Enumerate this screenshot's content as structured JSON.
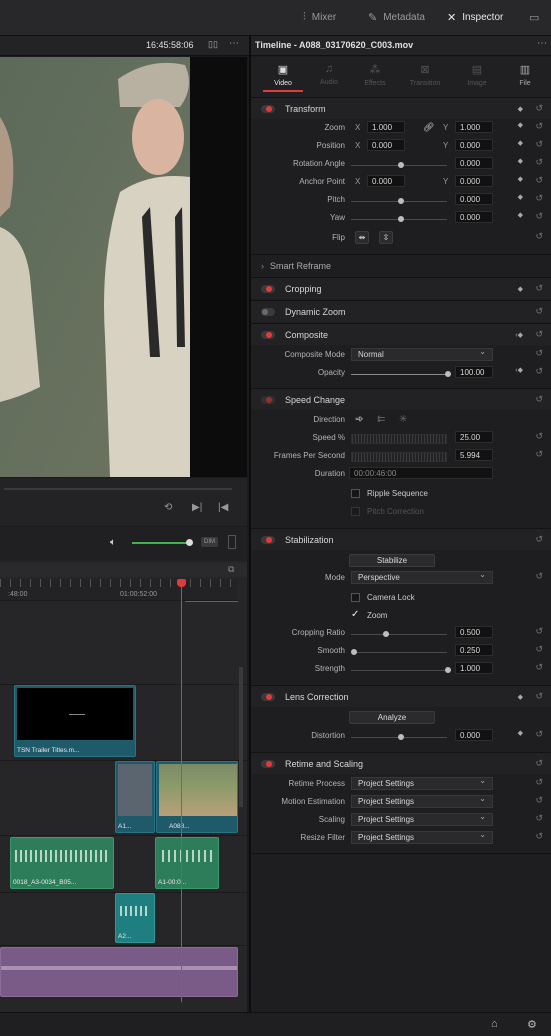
{
  "topbar": {
    "mixer": "Mixer",
    "metadata": "Metadata",
    "inspector": "Inspector"
  },
  "viewer": {
    "timecode": "16:45:58:06"
  },
  "inspector": {
    "title": "Timeline - A088_03170620_C003.mov",
    "tabs": [
      "Video",
      "Audio",
      "Effects",
      "Transition",
      "Image",
      "File"
    ],
    "transform": {
      "title": "Transform",
      "zoom_label": "Zoom",
      "zoom_x": "1.000",
      "zoom_y": "1.000",
      "position_label": "Position",
      "position_x": "0.000",
      "position_y": "0.000",
      "rotation_label": "Rotation Angle",
      "rotation": "0.000",
      "anchor_label": "Anchor Point",
      "anchor_x": "0.000",
      "anchor_y": "0.000",
      "pitch_label": "Pitch",
      "pitch": "0.000",
      "yaw_label": "Yaw",
      "yaw": "0.000",
      "flip_label": "Flip",
      "x": "X",
      "y": "Y"
    },
    "smart_reframe": "Smart Reframe",
    "cropping": "Cropping",
    "dynamic_zoom": "Dynamic Zoom",
    "composite": {
      "title": "Composite",
      "mode_label": "Composite Mode",
      "mode": "Normal",
      "opacity_label": "Opacity",
      "opacity": "100.00"
    },
    "speed": {
      "title": "Speed Change",
      "direction_label": "Direction",
      "speed_label": "Speed %",
      "speed": "25.00",
      "fps_label": "Frames Per Second",
      "fps": "5.994",
      "duration_label": "Duration",
      "duration": "00:00:46:00",
      "ripple": "Ripple Sequence",
      "pitch_corr": "Pitch Correction"
    },
    "stabilization": {
      "title": "Stabilization",
      "stabilize_btn": "Stabilize",
      "mode_label": "Mode",
      "mode": "Perspective",
      "camera_lock": "Camera Lock",
      "zoom": "Zoom",
      "crop_label": "Cropping Ratio",
      "crop": "0.500",
      "smooth_label": "Smooth",
      "smooth": "0.250",
      "strength_label": "Strength",
      "strength": "1.000"
    },
    "lens": {
      "title": "Lens Correction",
      "analyze_btn": "Analyze",
      "distortion_label": "Distortion",
      "distortion": "0.000"
    },
    "retime": {
      "title": "Retime and Scaling",
      "process_label": "Retime Process",
      "process": "Project Settings",
      "motion_label": "Motion Estimation",
      "motion": "Project Settings",
      "scaling_label": "Scaling",
      "scaling": "Project Settings",
      "resize_label": "Resize Filter",
      "resize": "Project Settings"
    }
  },
  "timeline": {
    "tc_left": ":48:00",
    "tc_mid": "01:00:52:00",
    "dim": "DIM",
    "clips": {
      "title_clip": "TSN Trailer Titles.m...",
      "a1": "A1...",
      "a088": "A088...",
      "audio1": "0018_A3-0034_B05...",
      "audio2": "A1-00:0...",
      "audio3": "A2..."
    }
  },
  "colors": {
    "accent_red": "#e03a3a",
    "video_teal": "#1f5a6a",
    "audio_green": "#2d7d5a",
    "music_purple": "#7a5a86"
  }
}
